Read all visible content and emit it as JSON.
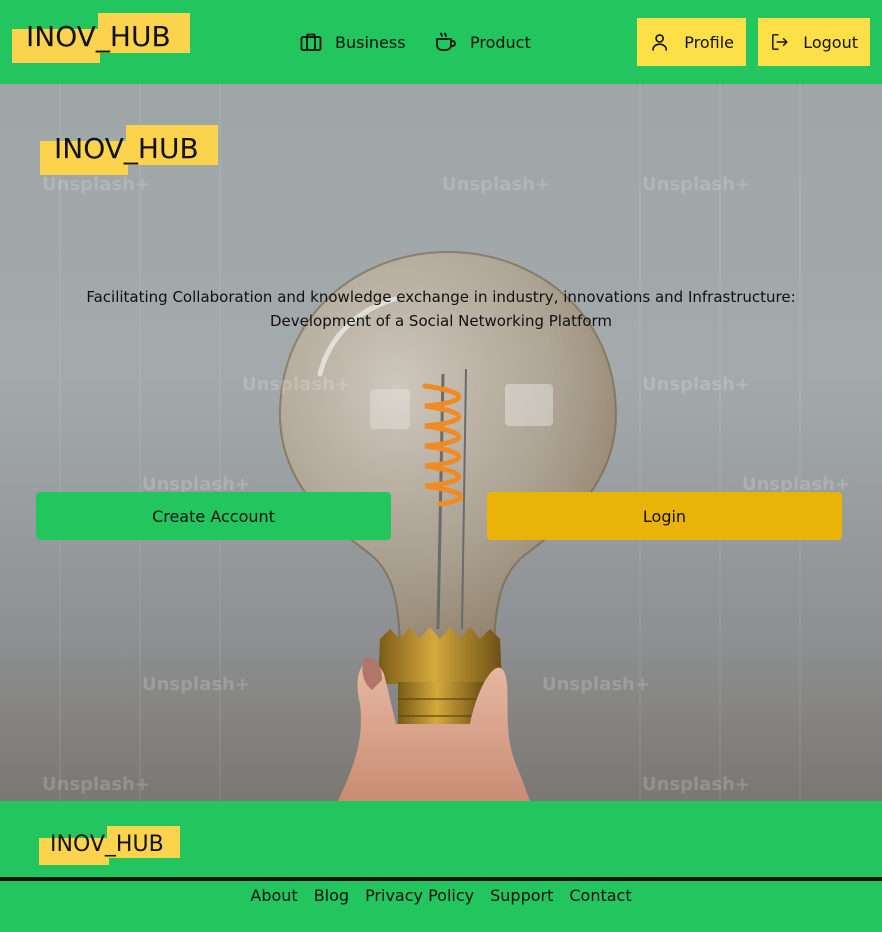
{
  "brand": {
    "name": "INOV_HUB"
  },
  "header": {
    "nav": [
      {
        "label": "Business",
        "icon": "briefcase-icon"
      },
      {
        "label": "Product",
        "icon": "coffee-cup-icon"
      }
    ],
    "profile_label": "Profile",
    "logout_label": "Logout"
  },
  "hero": {
    "tagline_line1": "Facilitating Collaboration and knowledge exchange in industry, innovations and Infrastructure:",
    "tagline_line2": "Development of a Social Networking Platform",
    "create_account_label": "Create Account",
    "login_label": "Login",
    "watermark_text": "Unsplash+"
  },
  "footer": {
    "links": [
      "About",
      "Blog",
      "Privacy Policy",
      "Support",
      "Contact"
    ]
  },
  "colors": {
    "brand_green": "#22c55e",
    "highlight_yellow": "#fcd34d",
    "button_yellow": "#fde047",
    "login_gold": "#eab308"
  }
}
